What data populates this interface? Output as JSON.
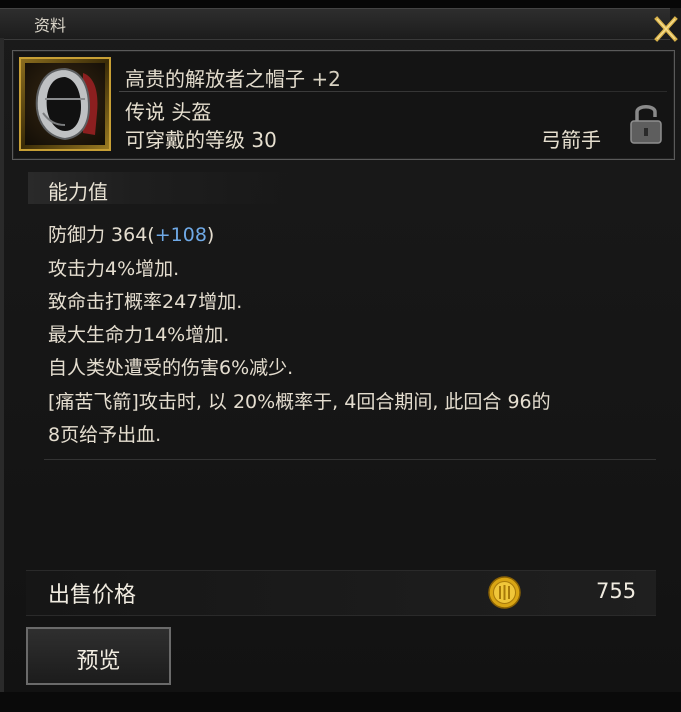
{
  "window": {
    "title": "资料"
  },
  "item": {
    "name": "高贵的解放者之帽子",
    "enhance": "+2",
    "grade": "传说 头盔",
    "level_text": "可穿戴的等级 30",
    "class": "弓箭手",
    "icon": "hood-helmet-icon",
    "lock_icon": "padlock-icon"
  },
  "stats": {
    "title": "能力值",
    "defense_label": "防御力 364(",
    "defense_bonus": "+108",
    "defense_close": ")",
    "lines": [
      "攻击力4%增加.",
      "致命击打概率247增加.",
      "最大生命力14%增加.",
      "自人类处遭受的伤害6%减少.",
      "[痛苦飞箭]攻击时, 以 20%概率于, 4回合期间, 此回合 96的",
      "8页给予出血."
    ]
  },
  "sale": {
    "label": "出售价格",
    "value": "755",
    "coin_icon": "gold-coin-icon"
  },
  "buttons": {
    "preview": "预览"
  },
  "colors": {
    "bonus": "#6fa9e6",
    "frame_gold": "#c79f35"
  }
}
